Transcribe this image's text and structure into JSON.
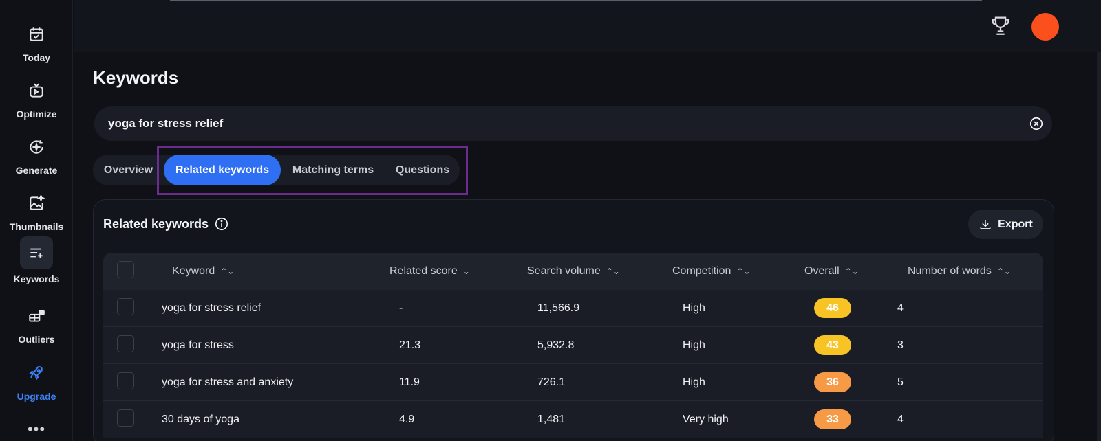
{
  "sidebar": {
    "items": [
      {
        "label": "Today",
        "icon": "calendar-check-icon"
      },
      {
        "label": "Optimize",
        "icon": "video-optimize-icon"
      },
      {
        "label": "Generate",
        "icon": "generate-icon"
      },
      {
        "label": "Thumbnails",
        "icon": "image-sparkle-icon"
      },
      {
        "label": "Keywords",
        "icon": "keywords-list-icon"
      },
      {
        "label": "Outliers",
        "icon": "outliers-icon"
      },
      {
        "label": "Upgrade",
        "icon": "rocket-icon"
      }
    ],
    "more": "•••",
    "active": "Keywords"
  },
  "header": {
    "avatar_color": "#fb4f1e"
  },
  "page": {
    "title": "Keywords"
  },
  "search": {
    "value": "yoga for stress relief"
  },
  "tabs": [
    {
      "label": "Overview"
    },
    {
      "label": "Related keywords",
      "active": true
    },
    {
      "label": "Matching terms"
    },
    {
      "label": "Questions"
    }
  ],
  "card": {
    "title": "Related keywords",
    "export_label": "Export"
  },
  "table": {
    "columns": [
      "Keyword",
      "Related score",
      "Search volume",
      "Competition",
      "Overall",
      "Number of words"
    ],
    "rows": [
      {
        "keyword": "yoga for stress relief",
        "related_score": "-",
        "search_volume": "11,566.9",
        "competition": "High",
        "overall": "46",
        "overall_color": "#f7c325",
        "words": "4"
      },
      {
        "keyword": "yoga for stress",
        "related_score": "21.3",
        "search_volume": "5,932.8",
        "competition": "High",
        "overall": "43",
        "overall_color": "#f7c325",
        "words": "3"
      },
      {
        "keyword": "yoga for stress and anxiety",
        "related_score": "11.9",
        "search_volume": "726.1",
        "competition": "High",
        "overall": "36",
        "overall_color": "#f79a45",
        "words": "5"
      },
      {
        "keyword": "30 days of yoga",
        "related_score": "4.9",
        "search_volume": "1,481",
        "competition": "Very high",
        "overall": "33",
        "overall_color": "#f79a45",
        "words": "4"
      }
    ]
  },
  "colors": {
    "accent": "#2f6ff4",
    "upgrade": "#3b82f6",
    "highlight_border": "#6b2c91"
  }
}
